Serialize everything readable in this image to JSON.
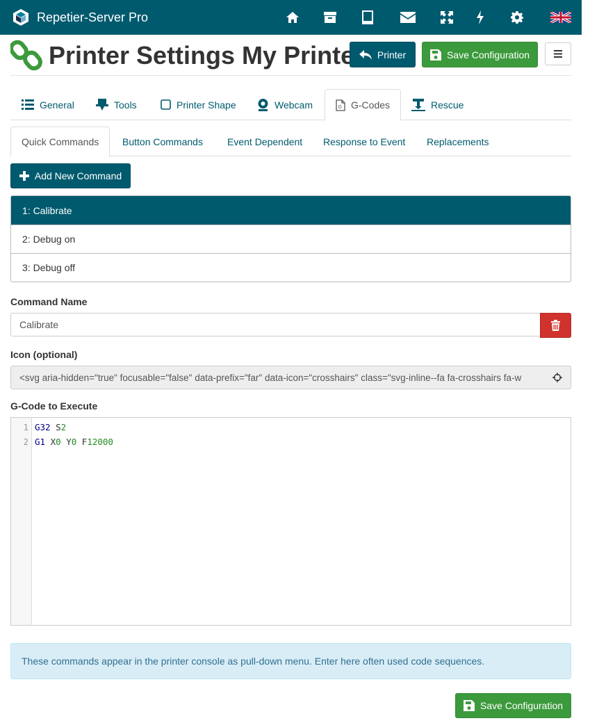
{
  "app": {
    "title": "Repetier-Server Pro"
  },
  "navbar": {
    "icons": [
      "home-icon",
      "archive-icon",
      "tablet-icon",
      "envelope-icon",
      "expand-icon",
      "bolt-icon",
      "gear-icon",
      "uk-flag-icon"
    ]
  },
  "header": {
    "title": "Printer Settings My Printer",
    "printer_button": "Printer",
    "save_button": "Save Configuration"
  },
  "main_tabs": [
    {
      "label": "General",
      "icon": "list-icon"
    },
    {
      "label": "Tools",
      "icon": "extruder-icon"
    },
    {
      "label": "Printer Shape",
      "icon": "square-icon"
    },
    {
      "label": "Webcam",
      "icon": "webcam-icon"
    },
    {
      "label": "G-Codes",
      "icon": "gcode-file-icon",
      "active": true
    },
    {
      "label": "Rescue",
      "icon": "rescue-icon"
    }
  ],
  "sub_tabs": [
    {
      "label": "Quick Commands",
      "active": true
    },
    {
      "label": "Button Commands"
    },
    {
      "label": "Event Dependent"
    },
    {
      "label": "Response to Event"
    },
    {
      "label": "Replacements"
    }
  ],
  "add_command_button": "Add New Command",
  "commands": [
    {
      "label": "1: Calibrate",
      "active": true
    },
    {
      "label": "2: Debug on"
    },
    {
      "label": "3: Debug off"
    }
  ],
  "form": {
    "command_name_label": "Command Name",
    "command_name_value": "Calibrate",
    "icon_label": "Icon (optional)",
    "icon_value": "<svg aria-hidden=\"true\" focusable=\"false\" data-prefix=\"far\" data-icon=\"crosshairs\" class=\"svg-inline--fa fa-crosshairs fa-w",
    "gcode_label": "G-Code to Execute"
  },
  "editor": {
    "line_numbers": [
      "1",
      "2"
    ],
    "lines": [
      [
        {
          "t": "G32",
          "c": "kw"
        },
        {
          "t": " ",
          "c": "txt"
        },
        {
          "t": "S",
          "c": "txt"
        },
        {
          "t": "2",
          "c": "num"
        }
      ],
      [
        {
          "t": "G1",
          "c": "kw"
        },
        {
          "t": " ",
          "c": "txt"
        },
        {
          "t": "X",
          "c": "txt"
        },
        {
          "t": "0",
          "c": "num"
        },
        {
          "t": " ",
          "c": "txt"
        },
        {
          "t": "Y",
          "c": "txt"
        },
        {
          "t": "0",
          "c": "num"
        },
        {
          "t": " ",
          "c": "txt"
        },
        {
          "t": "F",
          "c": "txt"
        },
        {
          "t": "12000",
          "c": "num"
        }
      ]
    ]
  },
  "info_text": "These commands appear in the printer console as pull-down menu. Enter here often used code sequences.",
  "footer": {
    "save_button": "Save Configuration"
  },
  "colors": {
    "primary": "#005a6e",
    "success": "#3c9a3c",
    "danger": "#d0322d",
    "info_bg": "#d9edf7",
    "info_text": "#31708f"
  }
}
